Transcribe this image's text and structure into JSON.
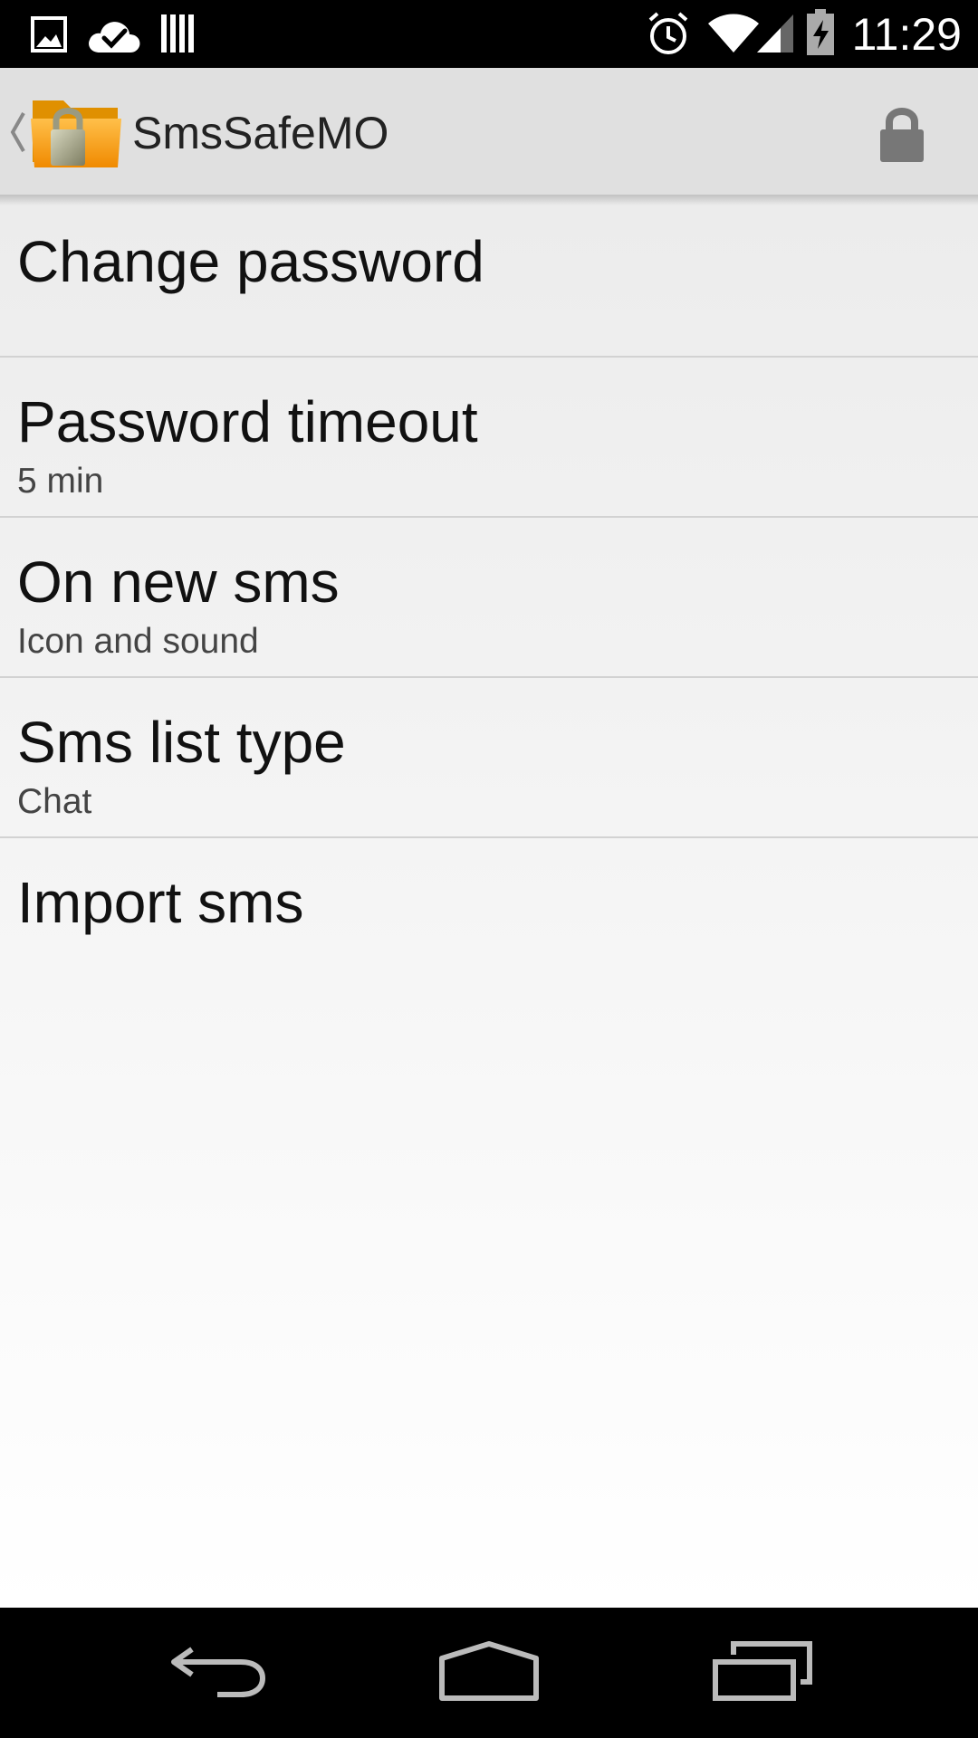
{
  "status_bar": {
    "time": "11:29",
    "icons": [
      "image-notification-icon",
      "cloud-check-icon",
      "barcode-icon",
      "alarm-icon",
      "wifi-icon",
      "signal-icon",
      "battery-charging-icon"
    ]
  },
  "action_bar": {
    "title": "SmsSafeMO",
    "app_icon": "folder-lock-icon",
    "action_icon": "lock-icon"
  },
  "preferences": [
    {
      "title": "Change password",
      "summary": ""
    },
    {
      "title": "Password timeout",
      "summary": "5 min"
    },
    {
      "title": "On new sms",
      "summary": "Icon and sound"
    },
    {
      "title": "Sms list type",
      "summary": "Chat"
    },
    {
      "title": "Import sms",
      "summary": ""
    }
  ],
  "nav_bar": {
    "buttons": [
      "back-icon",
      "home-icon",
      "recents-icon"
    ]
  }
}
